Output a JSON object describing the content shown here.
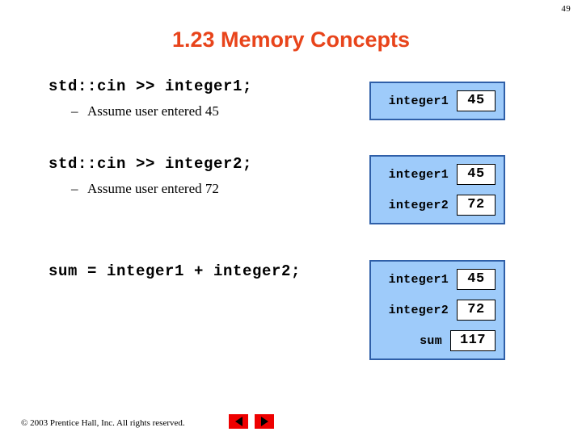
{
  "slide": {
    "page_number": "49",
    "title": "1.23 Memory Concepts",
    "colors": {
      "title": "#e8441b",
      "panel_fill": "#9ecbfa",
      "panel_border": "#2f5fa8",
      "nav_button": "#ee0000"
    }
  },
  "blocks": [
    {
      "code": "std::cin >> integer1;",
      "bullet_dash": "–",
      "bullet": "Assume user entered 45"
    },
    {
      "code": "std::cin >> integer2;",
      "bullet_dash": "–",
      "bullet": "Assume user entered 72"
    },
    {
      "code": "sum = integer1 + integer2;",
      "bullet_dash": "",
      "bullet": ""
    }
  ],
  "memory_panels": [
    {
      "rows": [
        {
          "label": "integer1",
          "value": "45"
        }
      ]
    },
    {
      "rows": [
        {
          "label": "integer1",
          "value": "45"
        },
        {
          "label": "integer2",
          "value": "72"
        }
      ]
    },
    {
      "rows": [
        {
          "label": "integer1",
          "value": "45"
        },
        {
          "label": "integer2",
          "value": "72"
        },
        {
          "label": "sum",
          "value": "117"
        }
      ]
    }
  ],
  "footer": {
    "copyright": "© 2003 Prentice Hall, Inc.  All rights reserved.",
    "prev_icon": "triangle-left-icon",
    "next_icon": "triangle-right-icon"
  }
}
